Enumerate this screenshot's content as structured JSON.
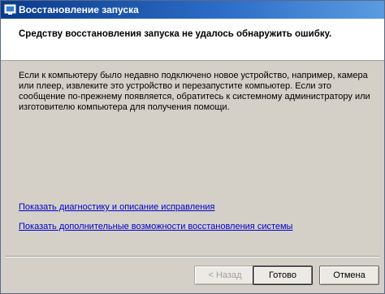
{
  "window": {
    "title": "Восстановление запуска",
    "icon": "startup-repair-icon"
  },
  "header": {
    "message": "Средству восстановления запуска не удалось обнаружить ошибку."
  },
  "main": {
    "description": "Если к компьютеру было недавно подключено новое устройство, например, камера или плеер, извлеките это устройство и перезапустите компьютер. Если это сообщение по-прежнему появляется, обратитесь к системному администратору или изготовителю компьютера для получения помощи.",
    "links": [
      {
        "label": "Показать диагностику и описание исправления"
      },
      {
        "label": "Показать дополнительные возможности восстановления системы"
      }
    ]
  },
  "buttons": {
    "back_label": "< Назад",
    "finish_label": "Готово",
    "cancel_label": "Отмена"
  },
  "colors": {
    "titlebar": "#0a3a8a",
    "dialog_background": "#d4d0c8",
    "link": "#0000cc"
  }
}
